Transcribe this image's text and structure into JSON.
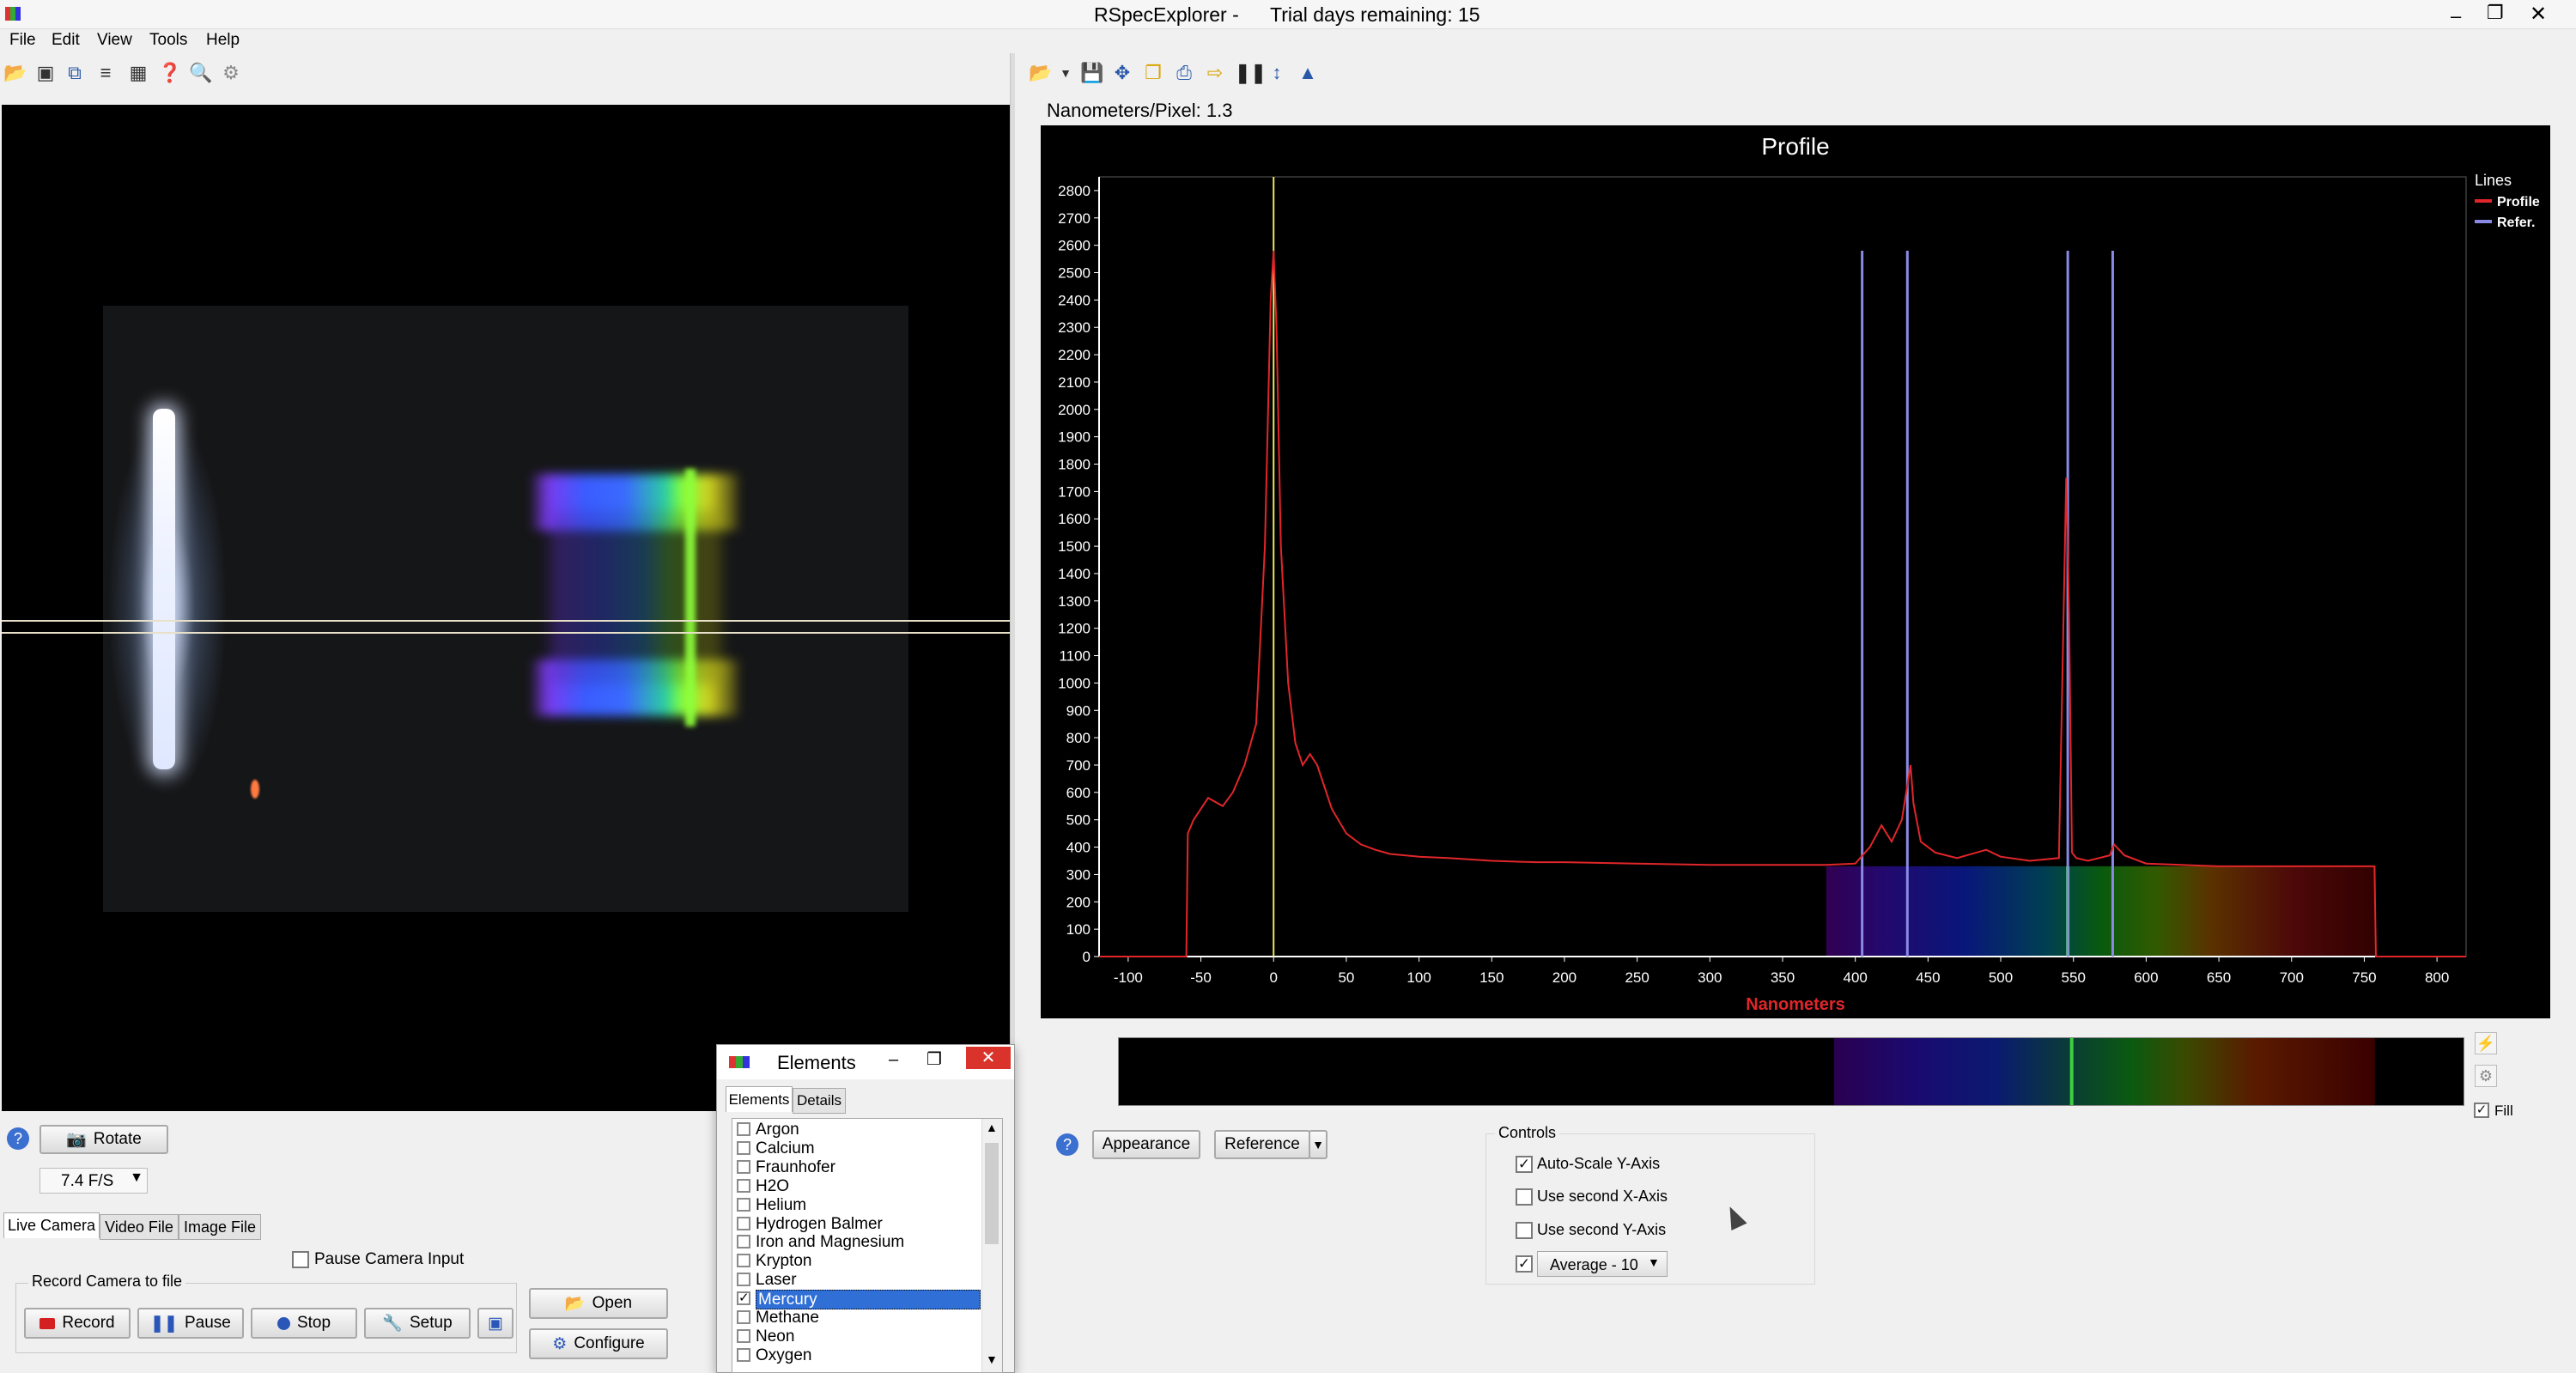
{
  "app": {
    "title": "RSpecExplorer -",
    "trial": "Trial days remaining: 15"
  },
  "menu": [
    "File",
    "Edit",
    "View",
    "Tools",
    "Help"
  ],
  "camera_panel": {
    "rotate_label": "Rotate",
    "fps_value": "7.4 F/S",
    "tabs": [
      "Live Camera",
      "Video File",
      "Image File"
    ],
    "pause_label": "Pause Camera Input",
    "record_group": "Record Camera to file",
    "buttons": {
      "record": "Record",
      "pause": "Pause",
      "stop": "Stop",
      "setup": "Setup",
      "open": "Open",
      "configure": "Configure"
    }
  },
  "elements_window": {
    "title": "Elements",
    "tabs": [
      "Elements",
      "Details"
    ],
    "items": [
      {
        "label": "Argon",
        "checked": false
      },
      {
        "label": "Calcium",
        "checked": false
      },
      {
        "label": "Fraunhofer",
        "checked": false
      },
      {
        "label": "H2O",
        "checked": false
      },
      {
        "label": "Helium",
        "checked": false
      },
      {
        "label": "Hydrogen Balmer",
        "checked": false
      },
      {
        "label": "Iron and Magnesium",
        "checked": false
      },
      {
        "label": "Krypton",
        "checked": false
      },
      {
        "label": "Laser",
        "checked": false
      },
      {
        "label": "Mercury",
        "checked": true,
        "selected": true
      },
      {
        "label": "Methane",
        "checked": false
      },
      {
        "label": "Neon",
        "checked": false
      },
      {
        "label": "Oxygen",
        "checked": false
      }
    ]
  },
  "profile_panel": {
    "scale_text": "Nanometers/Pixel: 1.3",
    "appearance_label": "Appearance",
    "reference_label": "Reference",
    "fill_label": "Fill",
    "controls": {
      "title": "Controls",
      "autoscale": "Auto-Scale Y-Axis",
      "second_x": "Use second X-Axis",
      "second_y": "Use second Y-Axis",
      "average": "Average - 10"
    }
  },
  "chart_data": {
    "type": "line",
    "title": "Profile",
    "xlabel": "Nanometers",
    "ylabel": "",
    "xlim": [
      -120,
      820
    ],
    "ylim": [
      0,
      2850
    ],
    "x_ticks": [
      -100,
      -50,
      0,
      50,
      100,
      150,
      200,
      250,
      300,
      350,
      400,
      450,
      500,
      550,
      600,
      650,
      700,
      750,
      800
    ],
    "y_ticks": [
      0,
      100,
      200,
      300,
      400,
      500,
      600,
      700,
      800,
      900,
      1000,
      1100,
      1200,
      1300,
      1400,
      1500,
      1600,
      1700,
      1800,
      1900,
      2000,
      2100,
      2200,
      2300,
      2400,
      2500,
      2600,
      2700,
      2800
    ],
    "legend": {
      "title": "Lines",
      "position": "top-right",
      "entries": [
        {
          "name": "Profile",
          "color": "#e0262a"
        },
        {
          "name": "Refer.",
          "color": "#8a8ae6"
        }
      ]
    },
    "series": [
      {
        "name": "Profile",
        "color": "#e0262a",
        "x": [
          -120,
          -60,
          -59,
          -55,
          -45,
          -35,
          -28,
          -20,
          -12,
          -6,
          -2,
          0,
          2,
          5,
          10,
          15,
          20,
          25,
          30,
          35,
          40,
          50,
          60,
          70,
          80,
          100,
          120,
          150,
          180,
          200,
          250,
          300,
          350,
          380,
          400,
          410,
          418,
          425,
          432,
          438,
          440,
          445,
          455,
          470,
          490,
          500,
          520,
          540,
          545,
          547,
          549,
          552,
          560,
          575,
          578,
          585,
          600,
          650,
          700,
          757,
          758,
          820
        ],
        "y": [
          0,
          0,
          450,
          500,
          580,
          550,
          600,
          700,
          850,
          1500,
          2400,
          2580,
          2300,
          1500,
          1000,
          780,
          700,
          740,
          700,
          620,
          540,
          450,
          410,
          390,
          375,
          365,
          360,
          350,
          345,
          345,
          340,
          335,
          335,
          335,
          340,
          400,
          480,
          420,
          500,
          700,
          560,
          420,
          380,
          360,
          390,
          365,
          350,
          360,
          1750,
          1250,
          380,
          360,
          350,
          370,
          410,
          370,
          340,
          330,
          330,
          330,
          0,
          0
        ]
      }
    ],
    "reference_lines": [
      404.7,
      435.8,
      546.1,
      577.0
    ],
    "marker_x": 0
  }
}
